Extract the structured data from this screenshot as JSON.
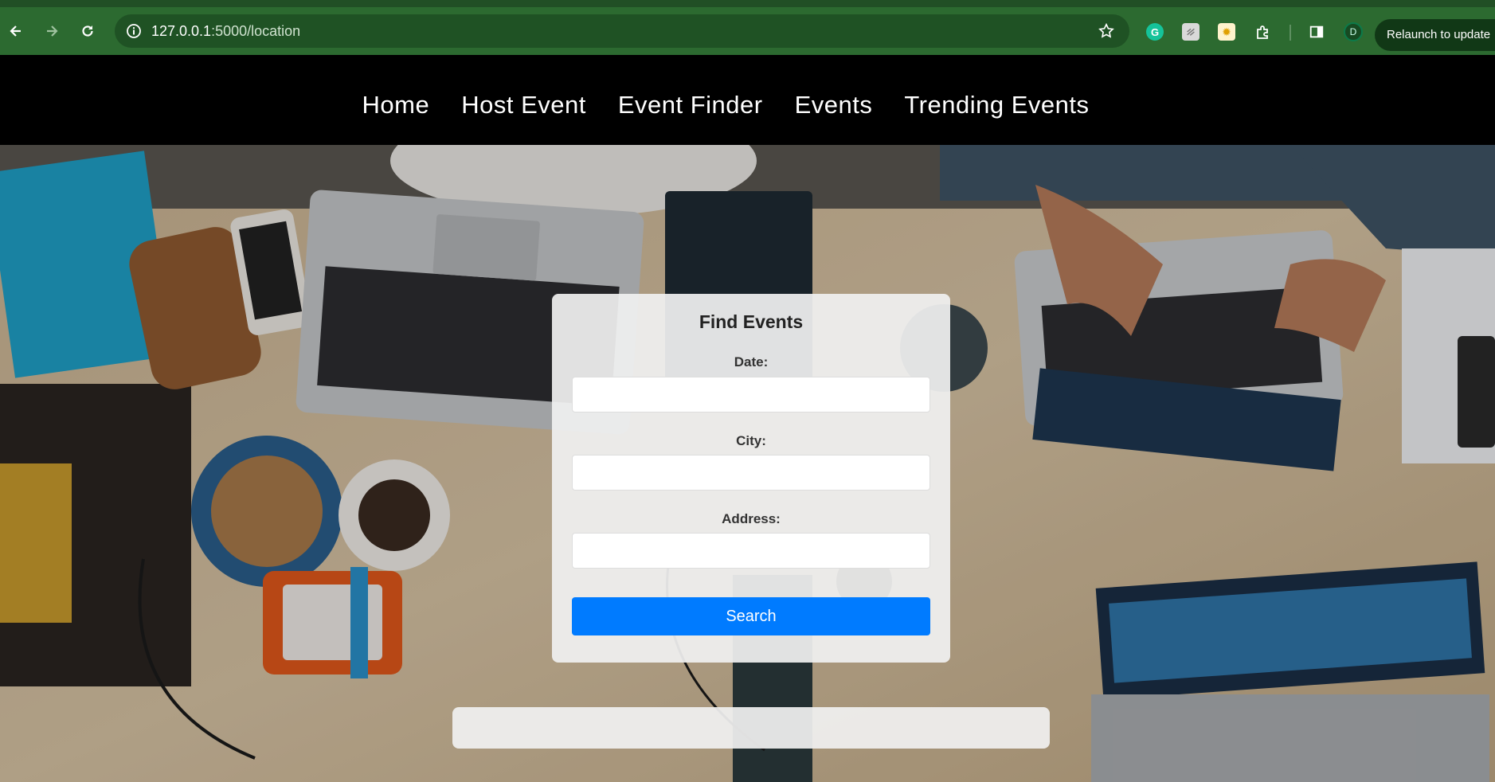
{
  "browser": {
    "url_host": "127.0.0.1",
    "url_rest": ":5000/location",
    "avatar_initial": "D",
    "relaunch_label": "Relaunch to update"
  },
  "nav": {
    "items": [
      "Home",
      "Host Event",
      "Event Finder",
      "Events",
      "Trending Events"
    ]
  },
  "form": {
    "title": "Find Events",
    "date_label": "Date:",
    "date_value": "",
    "city_label": "City:",
    "city_value": "",
    "address_label": "Address:",
    "address_value": "",
    "search_label": "Search"
  },
  "colors": {
    "browser_bar": "#2c6a30",
    "nav_bg": "#000000",
    "search_button": "#007bff"
  }
}
